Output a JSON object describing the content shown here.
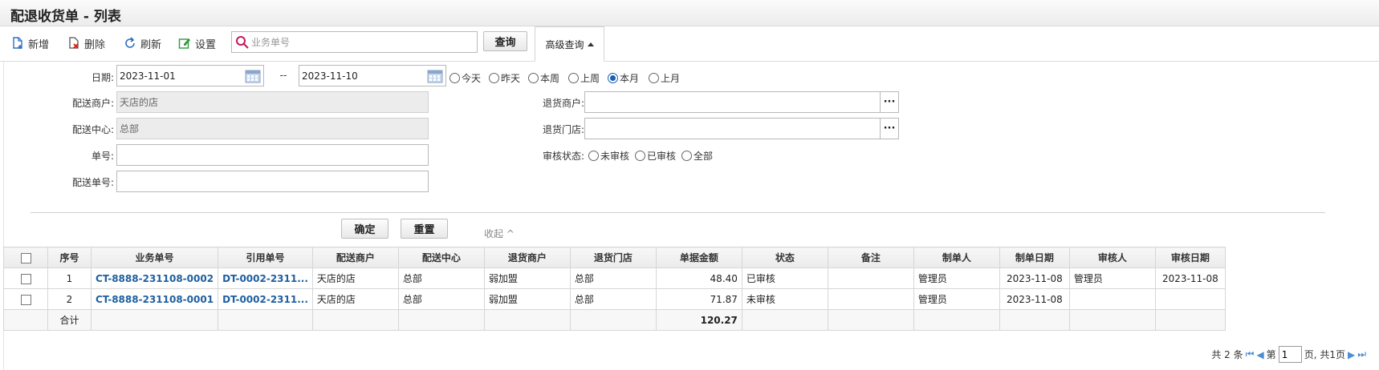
{
  "page": {
    "title": "配退收货单 - 列表"
  },
  "toolbar": {
    "add_label": "新增",
    "delete_label": "删除",
    "refresh_label": "刷新",
    "settings_label": "设置",
    "search_placeholder": "业务单号",
    "query_label": "查询",
    "advanced_label": "高级查询"
  },
  "filter": {
    "date_label": "日期:",
    "date_from": "2023-11-01",
    "date_sep": "--",
    "date_to": "2023-11-10",
    "quick_dates": [
      "今天",
      "昨天",
      "本周",
      "上周",
      "本月",
      "上月"
    ],
    "quick_date_selected": "本月",
    "merchant_label": "配送商户:",
    "merchant_value": "天店的店",
    "center_label": "配送中心:",
    "center_value": "总部",
    "order_no_label": "单号:",
    "order_no_value": "",
    "delivery_no_label": "配送单号:",
    "delivery_no_value": "",
    "return_merchant_label": "退货商户:",
    "return_merchant_value": "",
    "return_store_label": "退货门店:",
    "return_store_value": "",
    "audit_label": "审核状态:",
    "audit_options": [
      "未审核",
      "已审核",
      "全部"
    ],
    "audit_selected": "",
    "ellipsis": "···",
    "confirm_label": "确定",
    "reset_label": "重置",
    "collapse_label": "收起 ^"
  },
  "table": {
    "columns": [
      "序号",
      "业务单号",
      "引用单号",
      "配送商户",
      "配送中心",
      "退货商户",
      "退货门店",
      "单据金额",
      "状态",
      "备注",
      "制单人",
      "制单日期",
      "审核人",
      "审核日期"
    ],
    "rows": [
      [
        "1",
        "CT-8888-231108-0002",
        "DT-0002-2311...",
        "天店的店",
        "总部",
        "弱加盟",
        "总部",
        "48.40",
        "已审核",
        "",
        "管理员",
        "2023-11-08",
        "管理员",
        "2023-11-08"
      ],
      [
        "2",
        "CT-8888-231108-0001",
        "DT-0002-2311...",
        "天店的店",
        "总部",
        "弱加盟",
        "总部",
        "71.87",
        "未审核",
        "",
        "管理员",
        "2023-11-08",
        "",
        ""
      ]
    ],
    "total_label": "合计",
    "total_amount": "120.27"
  },
  "pager": {
    "total_text": "共 2 条",
    "page_prefix": "第",
    "current_page": "1",
    "page_suffix": "页, 共1页"
  },
  "colors": {
    "link": "#1e5fa0",
    "radio_on": "#1a5fb4",
    "pager_nav": "#4a8fd1"
  }
}
